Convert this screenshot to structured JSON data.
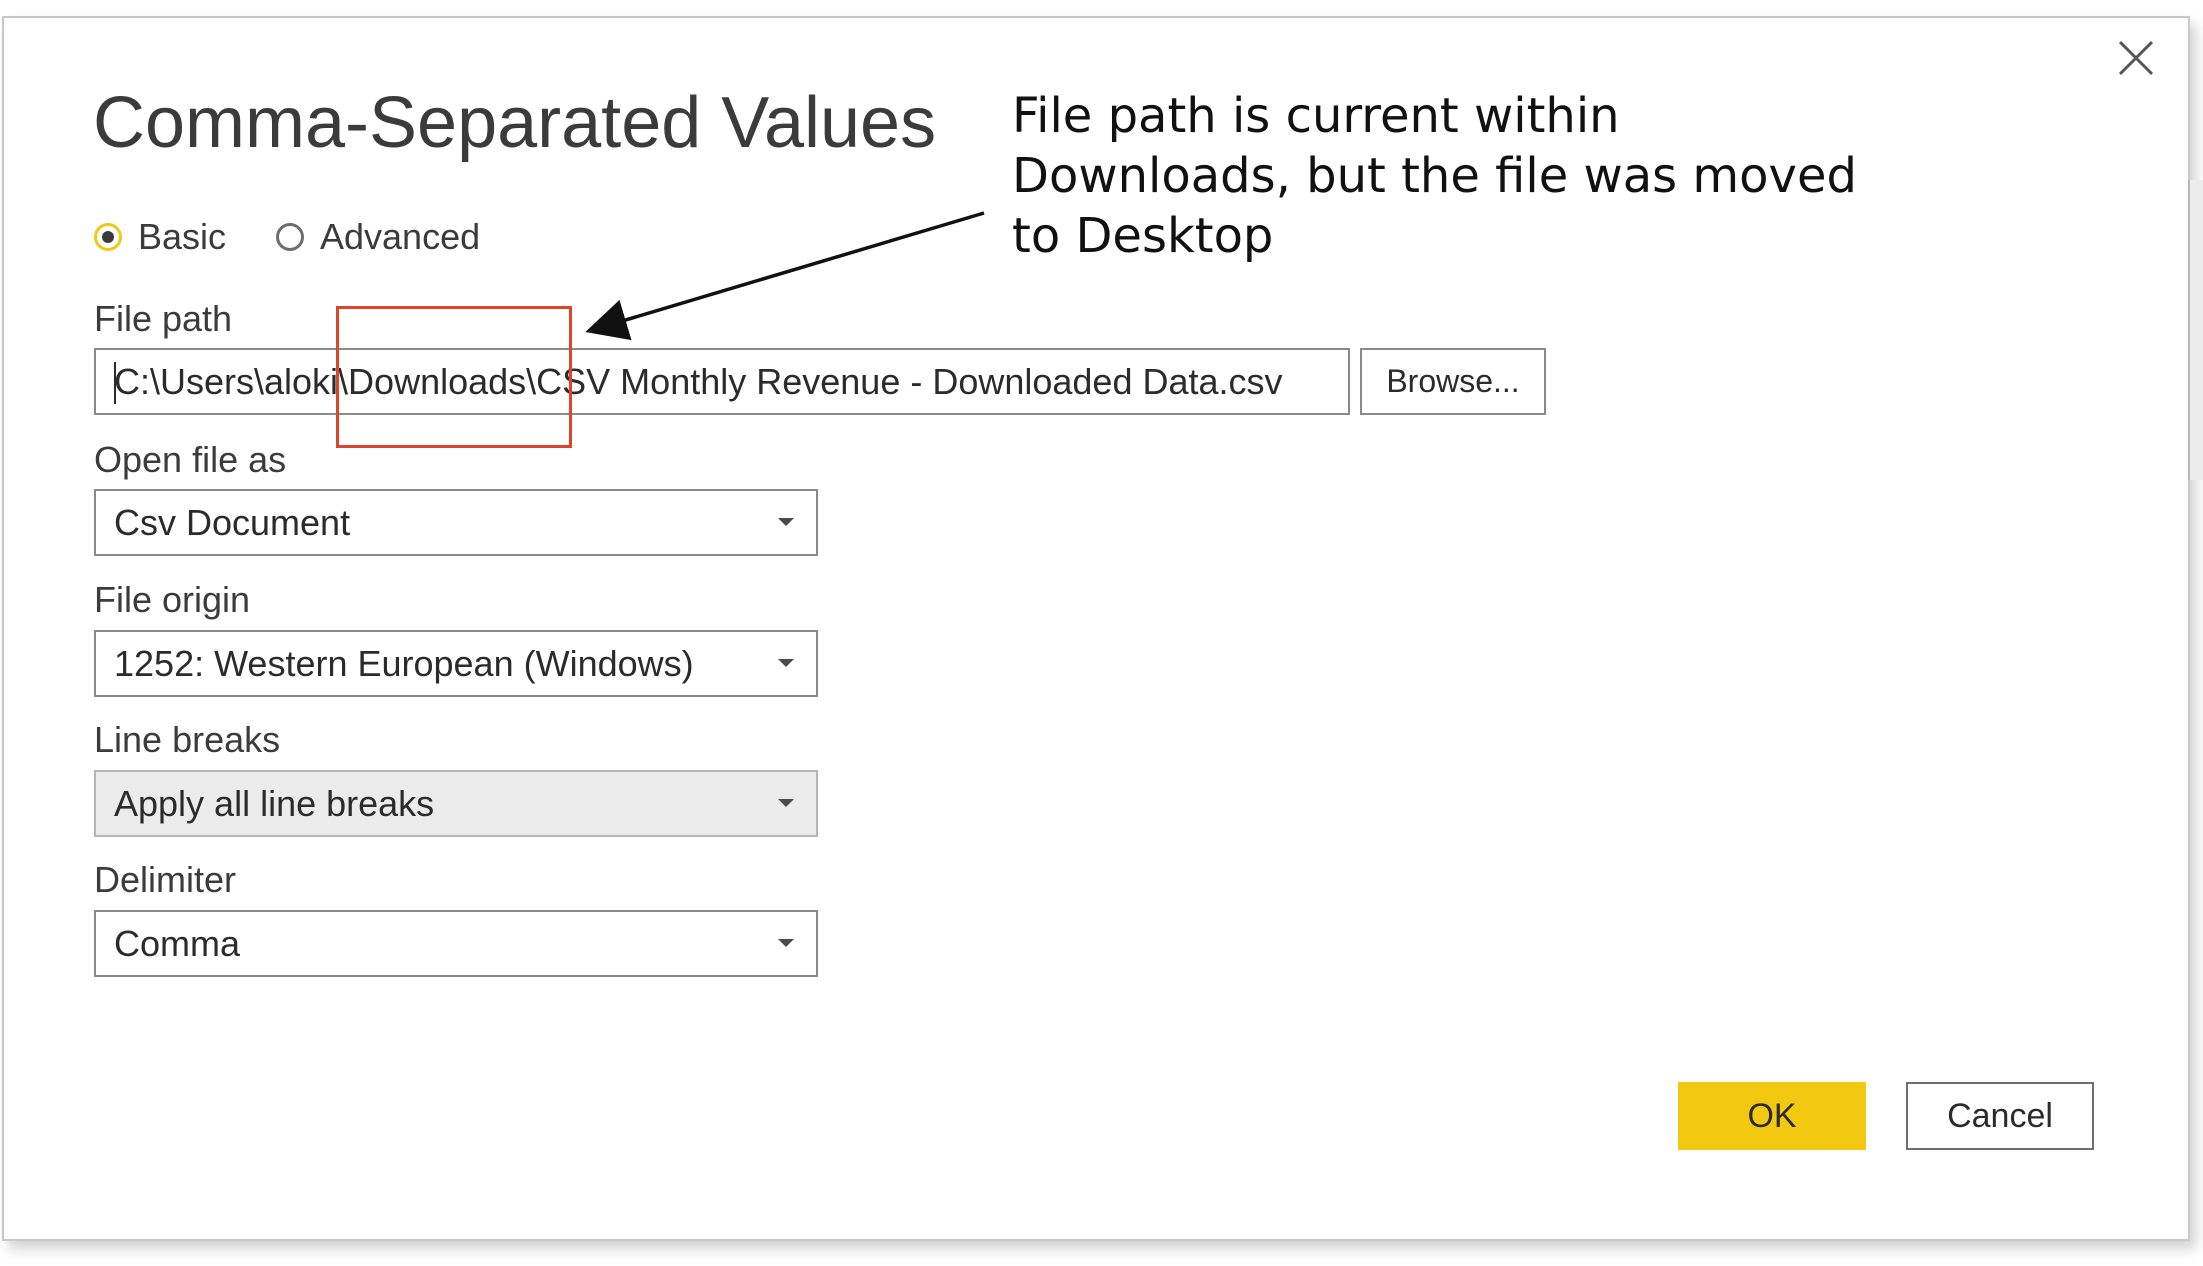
{
  "dialog": {
    "title": "Comma-Separated Values",
    "close_icon": "close-icon"
  },
  "mode": {
    "options": [
      {
        "label": "Basic",
        "checked": true
      },
      {
        "label": "Advanced",
        "checked": false
      }
    ]
  },
  "file_path": {
    "label": "File path",
    "value": "C:\\Users\\aloki\\Downloads\\CSV Monthly Revenue - Downloaded Data.csv",
    "browse_label": "Browse..."
  },
  "open_file_as": {
    "label": "Open file as",
    "value": "Csv Document"
  },
  "file_origin": {
    "label": "File origin",
    "value": "1252: Western European (Windows)"
  },
  "line_breaks": {
    "label": "Line breaks",
    "value": "Apply all line breaks",
    "disabled": true
  },
  "delimiter": {
    "label": "Delimiter",
    "value": "Comma"
  },
  "buttons": {
    "ok": "OK",
    "cancel": "Cancel"
  },
  "annotation": {
    "lines": [
      "File path is current within",
      "Downloads, but the file was moved",
      "to Desktop"
    ]
  },
  "colors": {
    "accent": "#f2c811",
    "highlight": "#e0432b"
  }
}
